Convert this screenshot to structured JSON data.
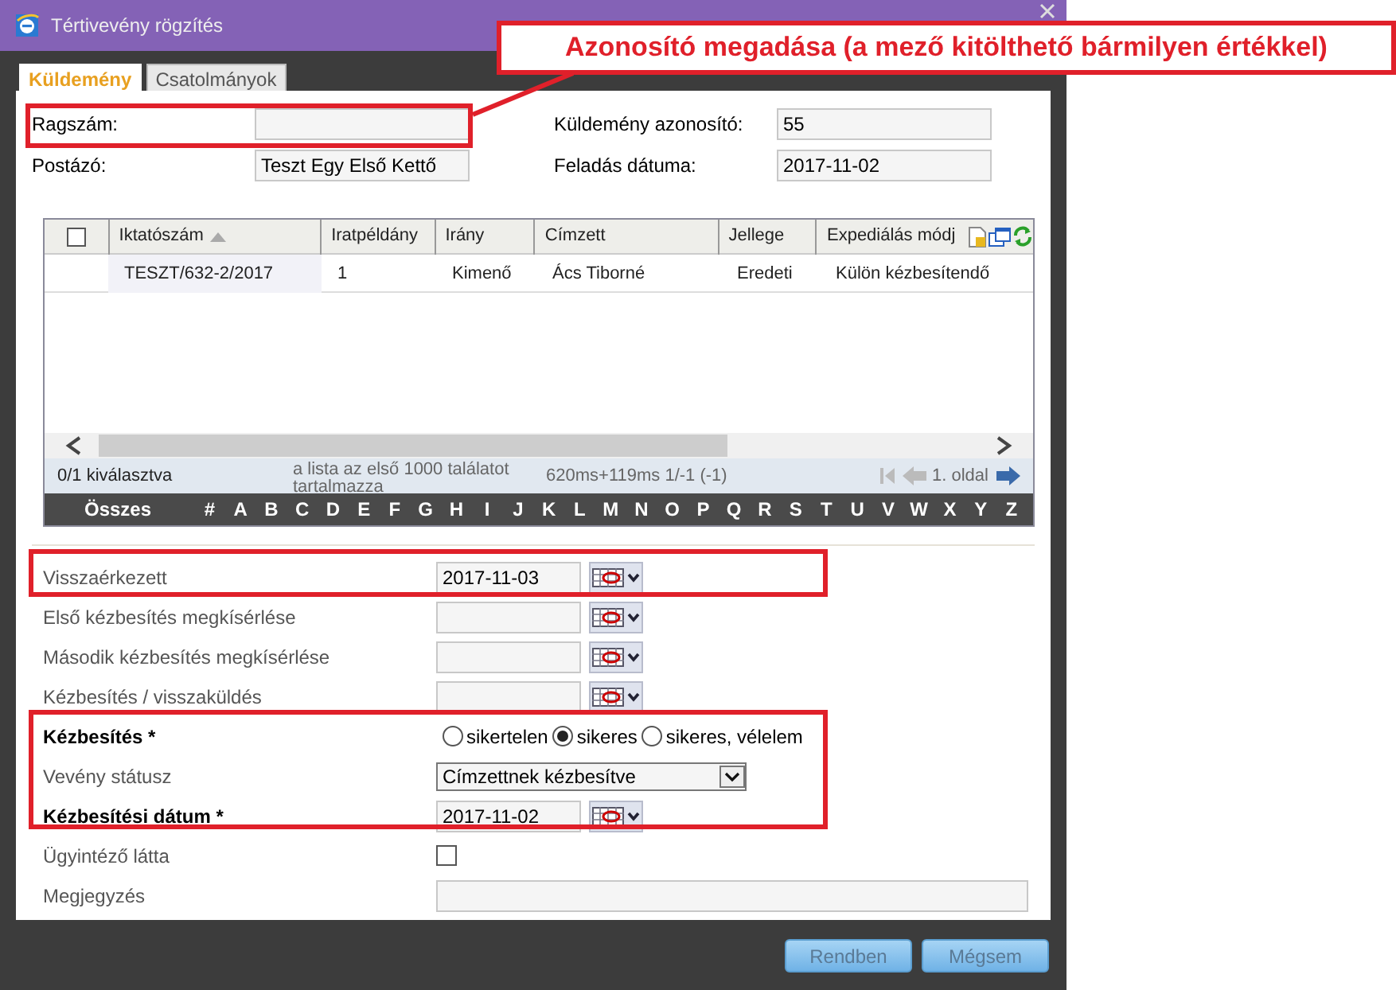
{
  "window": {
    "title": "Tértivevény rögzítés"
  },
  "annotation": {
    "text": "Azonosító megadása (a mező kitölthető bármilyen értékkel)"
  },
  "tabs": [
    {
      "label": "Küldemény",
      "selected": true
    },
    {
      "label": "Csatolmányok",
      "selected": false
    }
  ],
  "header_fields": [
    {
      "label": "Ragszám:"
    },
    {
      "label": "Küldemény azonosító:",
      "value": "55"
    },
    {
      "label": "Postázó:",
      "value": "Teszt Egy Első Kettő"
    },
    {
      "label": "Feladás dátuma:",
      "value": "2017-11-02"
    }
  ],
  "grid": {
    "select_all_checked": false,
    "columns": [
      {
        "label": "Iktatószám",
        "sorted": true
      },
      {
        "label": "Iratpéldány",
        "sorted": false
      },
      {
        "label": "Irány",
        "sorted": false
      },
      {
        "label": "Címzett",
        "sorted": false
      },
      {
        "label": "Jellege",
        "sorted": false
      },
      {
        "label": "Expediálás módj",
        "sorted": false
      }
    ],
    "rows": [
      {
        "selected": false,
        "cells": [
          "TESZT/632-2/2017",
          "1",
          "Kimenő",
          "Ács Tiborné",
          "Eredeti",
          "Külön kézbesítendő"
        ]
      }
    ],
    "selection_info": "0/1 kiválasztva",
    "note": "a lista az első 1000 találatot tartalmazza",
    "timing": "620ms+119ms 1/-1 (-1)",
    "page_label": "1. oldal",
    "alphabet": [
      "Összes",
      "#",
      "A",
      "B",
      "C",
      "D",
      "E",
      "F",
      "G",
      "H",
      "I",
      "J",
      "K",
      "L",
      "M",
      "N",
      "O",
      "P",
      "Q",
      "R",
      "S",
      "T",
      "U",
      "V",
      "W",
      "X",
      "Y",
      "Z"
    ]
  },
  "form": [
    {
      "kind": "date",
      "label": "Visszaérkezett",
      "required": false,
      "value": "2017-11-03"
    },
    {
      "kind": "date",
      "label": "Első kézbesítés megkísérlése",
      "required": false
    },
    {
      "kind": "date",
      "label": "Második kézbesítés megkísérlése",
      "required": false
    },
    {
      "kind": "date",
      "label": "Kézbesítés / visszaküldés",
      "required": false
    },
    {
      "kind": "radio",
      "label": "Kézbesítés *",
      "required": true,
      "options": [
        {
          "label": "sikertelen",
          "selected": false
        },
        {
          "label": "sikeres",
          "selected": true
        },
        {
          "label": "sikeres, vélelem",
          "selected": false
        }
      ]
    },
    {
      "kind": "select",
      "label": "Vevény státusz",
      "required": false,
      "value": "Címzettnek kézbesítve"
    },
    {
      "kind": "date",
      "label": "Kézbesítési dátum *",
      "required": true,
      "value": "2017-11-02"
    },
    {
      "kind": "checkbox",
      "label": "Ügyintéző látta",
      "required": false,
      "checked": false
    },
    {
      "kind": "text",
      "label": "Megjegyzés",
      "required": false
    }
  ],
  "buttons": [
    "Rendben",
    "Mégsem"
  ]
}
